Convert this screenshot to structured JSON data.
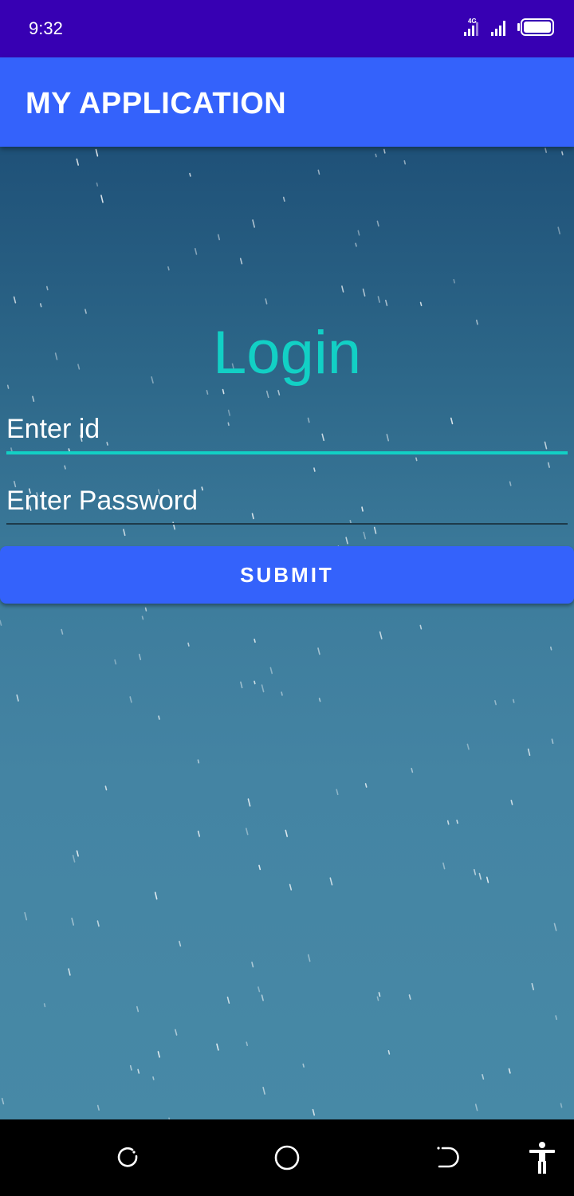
{
  "status_bar": {
    "time": "9:32",
    "network_label": "4G",
    "icons": [
      "signal-4g-icon",
      "signal-icon",
      "battery-icon"
    ]
  },
  "app_bar": {
    "title": "MY APPLICATION"
  },
  "login": {
    "title": "Login",
    "id_field": {
      "value": "",
      "placeholder": "Enter id"
    },
    "password_field": {
      "value": "",
      "placeholder": "Enter Password"
    },
    "submit_label": "SUBMIT"
  },
  "nav_bar": {
    "icons": [
      "recents-icon",
      "home-icon",
      "back-icon",
      "accessibility-icon"
    ]
  },
  "colors": {
    "status_bar": "#3700b3",
    "app_bar": "#3462fb",
    "accent": "#12d0c5",
    "button": "#3462fb",
    "background_top": "#1f5178",
    "background_bottom": "#4789a6"
  }
}
